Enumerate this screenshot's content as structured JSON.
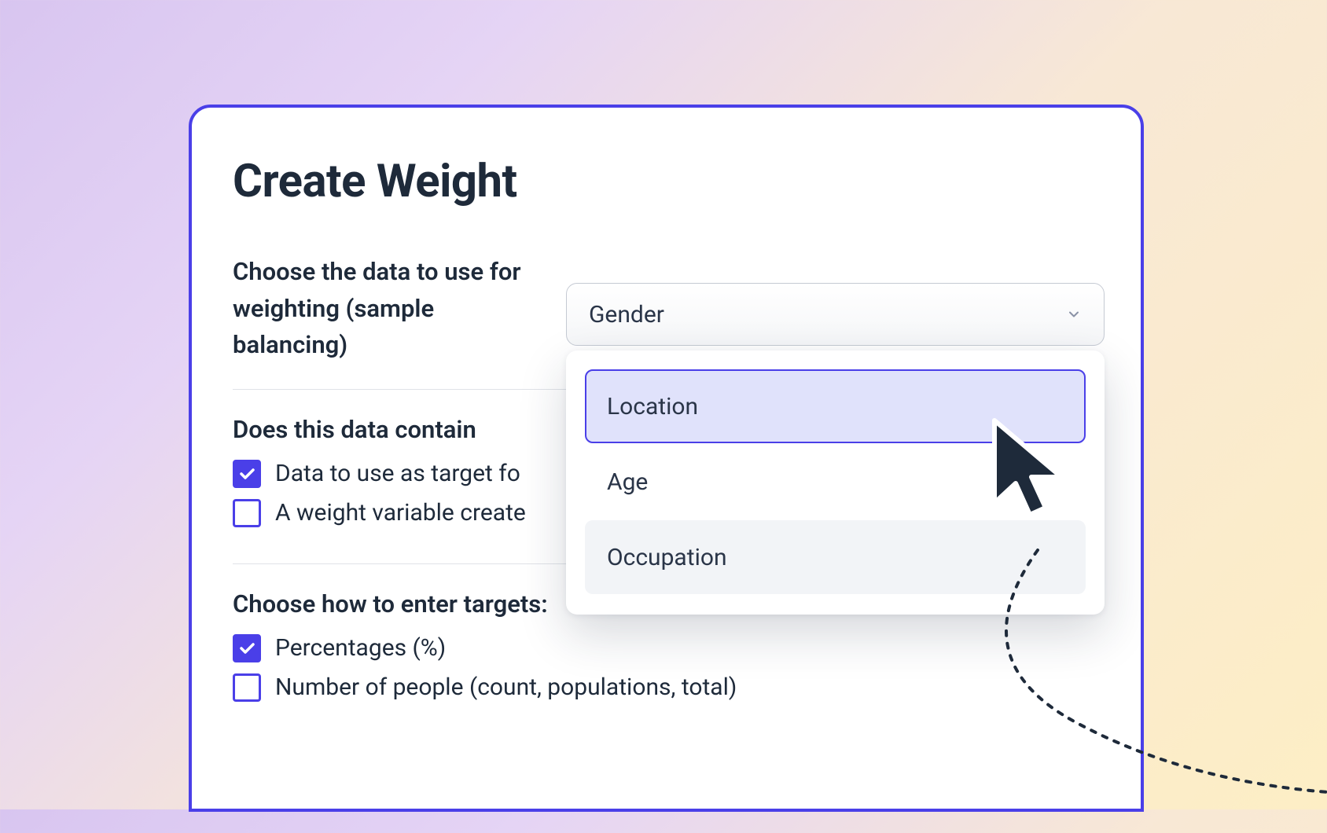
{
  "panel": {
    "title": "Create Weight"
  },
  "sections": {
    "choose_data": {
      "label": "Choose the data to use for weighting (sample balancing)"
    },
    "data_contain": {
      "heading": "Does this data contain",
      "options": [
        {
          "label": "Data to use as target fo",
          "checked": true
        },
        {
          "label": "A weight variable create",
          "checked": false
        }
      ]
    },
    "enter_targets": {
      "heading": "Choose how to enter targets:",
      "options": [
        {
          "label": "Percentages (%)",
          "checked": true
        },
        {
          "label": "Number of people (count, populations, total)",
          "checked": false
        }
      ]
    }
  },
  "select": {
    "value": "Gender",
    "options": [
      {
        "label": "Location",
        "state": "highlighted"
      },
      {
        "label": "Age",
        "state": "normal"
      },
      {
        "label": "Occupation",
        "state": "alt"
      }
    ]
  }
}
